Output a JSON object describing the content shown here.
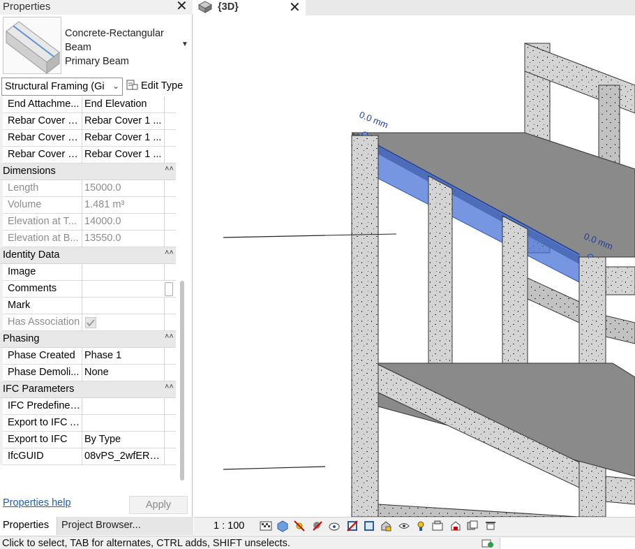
{
  "palette": {
    "title": "Properties",
    "type_name_lines": [
      "Concrete-Rectangular",
      "Beam",
      "Primary Beam"
    ],
    "filter": "Structural Framing (Gi",
    "edit_type": "Edit Type",
    "help_link": "Properties help",
    "apply": "Apply"
  },
  "rows_top": [
    {
      "k": "End Attachme...",
      "v": "End Elevation"
    },
    {
      "k": "Rebar Cover - ...",
      "v": "Rebar Cover 1 ..."
    },
    {
      "k": "Rebar Cover - ...",
      "v": "Rebar Cover 1 ..."
    },
    {
      "k": "Rebar Cover - ...",
      "v": "Rebar Cover 1 ..."
    }
  ],
  "groups": {
    "dimensions": "Dimensions",
    "identity": "Identity Data",
    "phasing": "Phasing",
    "ifc": "IFC Parameters"
  },
  "dimensions": [
    {
      "k": "Length",
      "v": "15000.0"
    },
    {
      "k": "Volume",
      "v": "1.481 m³"
    },
    {
      "k": "Elevation at T...",
      "v": "14000.0"
    },
    {
      "k": "Elevation at B...",
      "v": "13550.0"
    }
  ],
  "identity": [
    {
      "k": "Image",
      "v": ""
    },
    {
      "k": "Comments",
      "v": ""
    },
    {
      "k": "Mark",
      "v": ""
    },
    {
      "k": "Has Association",
      "v": ""
    }
  ],
  "phasing": [
    {
      "k": "Phase Created",
      "v": "Phase 1"
    },
    {
      "k": "Phase Demoli...",
      "v": "None"
    }
  ],
  "ifc": [
    {
      "k": "IFC Predefined...",
      "v": ""
    },
    {
      "k": "Export to IFC As",
      "v": ""
    },
    {
      "k": "Export to IFC",
      "v": "By Type"
    },
    {
      "k": "IfcGUID",
      "v": "08vPS_2wfERuR..."
    }
  ],
  "tabs": {
    "properties": "Properties",
    "browser": "Project Browser..."
  },
  "view": {
    "tab": "{3D}",
    "dim_left": "0.0 mm",
    "dim_right": "0.0 mm",
    "scale": "1 : 100"
  },
  "status": "Click to select, TAB for alternates, CTRL adds, SHIFT unselects.",
  "colors": {
    "selection": "#4a73d8",
    "concrete": "#d4d4d4",
    "slab": "#8a8a8a",
    "link": "#1a5fb4"
  }
}
